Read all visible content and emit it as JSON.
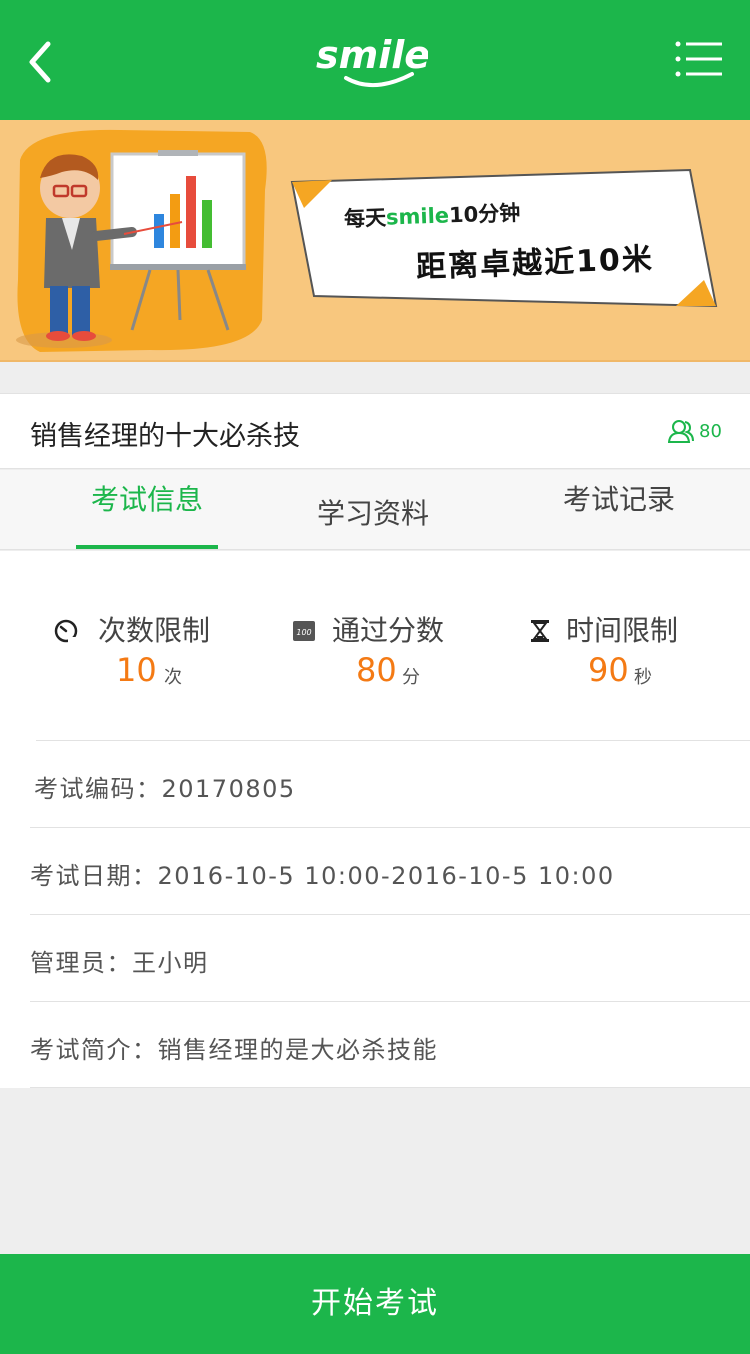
{
  "header": {
    "logo_text": "smile",
    "back_icon": "chevron-left-icon",
    "menu_icon": "list-menu-icon"
  },
  "banner": {
    "slogan_line1_prefix": "每天",
    "slogan_line1_brand": "smile",
    "slogan_line1_suffix": "10分钟",
    "slogan_line2": "距离卓越近10米"
  },
  "course": {
    "title": "销售经理的十大必杀技",
    "learner_count": "80"
  },
  "tabs": [
    {
      "label": "考试信息",
      "active": true
    },
    {
      "label": "学习资料",
      "active": false
    },
    {
      "label": "考试记录",
      "active": false
    }
  ],
  "stats": [
    {
      "icon": "speed-gauge-icon",
      "label": "次数限制",
      "value": "10",
      "unit": "次"
    },
    {
      "icon": "score-100-icon",
      "label": "通过分数",
      "value": "80",
      "unit": "分"
    },
    {
      "icon": "hourglass-icon",
      "label": "时间限制",
      "value": "90",
      "unit": "秒"
    }
  ],
  "info": {
    "code": "考试编码：20170805",
    "date": "考试日期：2016-10-5 10:00-2016-10-5 10:00",
    "admin": "管理员：王小明",
    "intro": "考试简介：销售经理的是大必杀技能"
  },
  "start_button": "开始考试",
  "colors": {
    "primary": "#1cb64b",
    "accent_orange": "#f47a14",
    "banner_bg": "#f8c77e"
  }
}
